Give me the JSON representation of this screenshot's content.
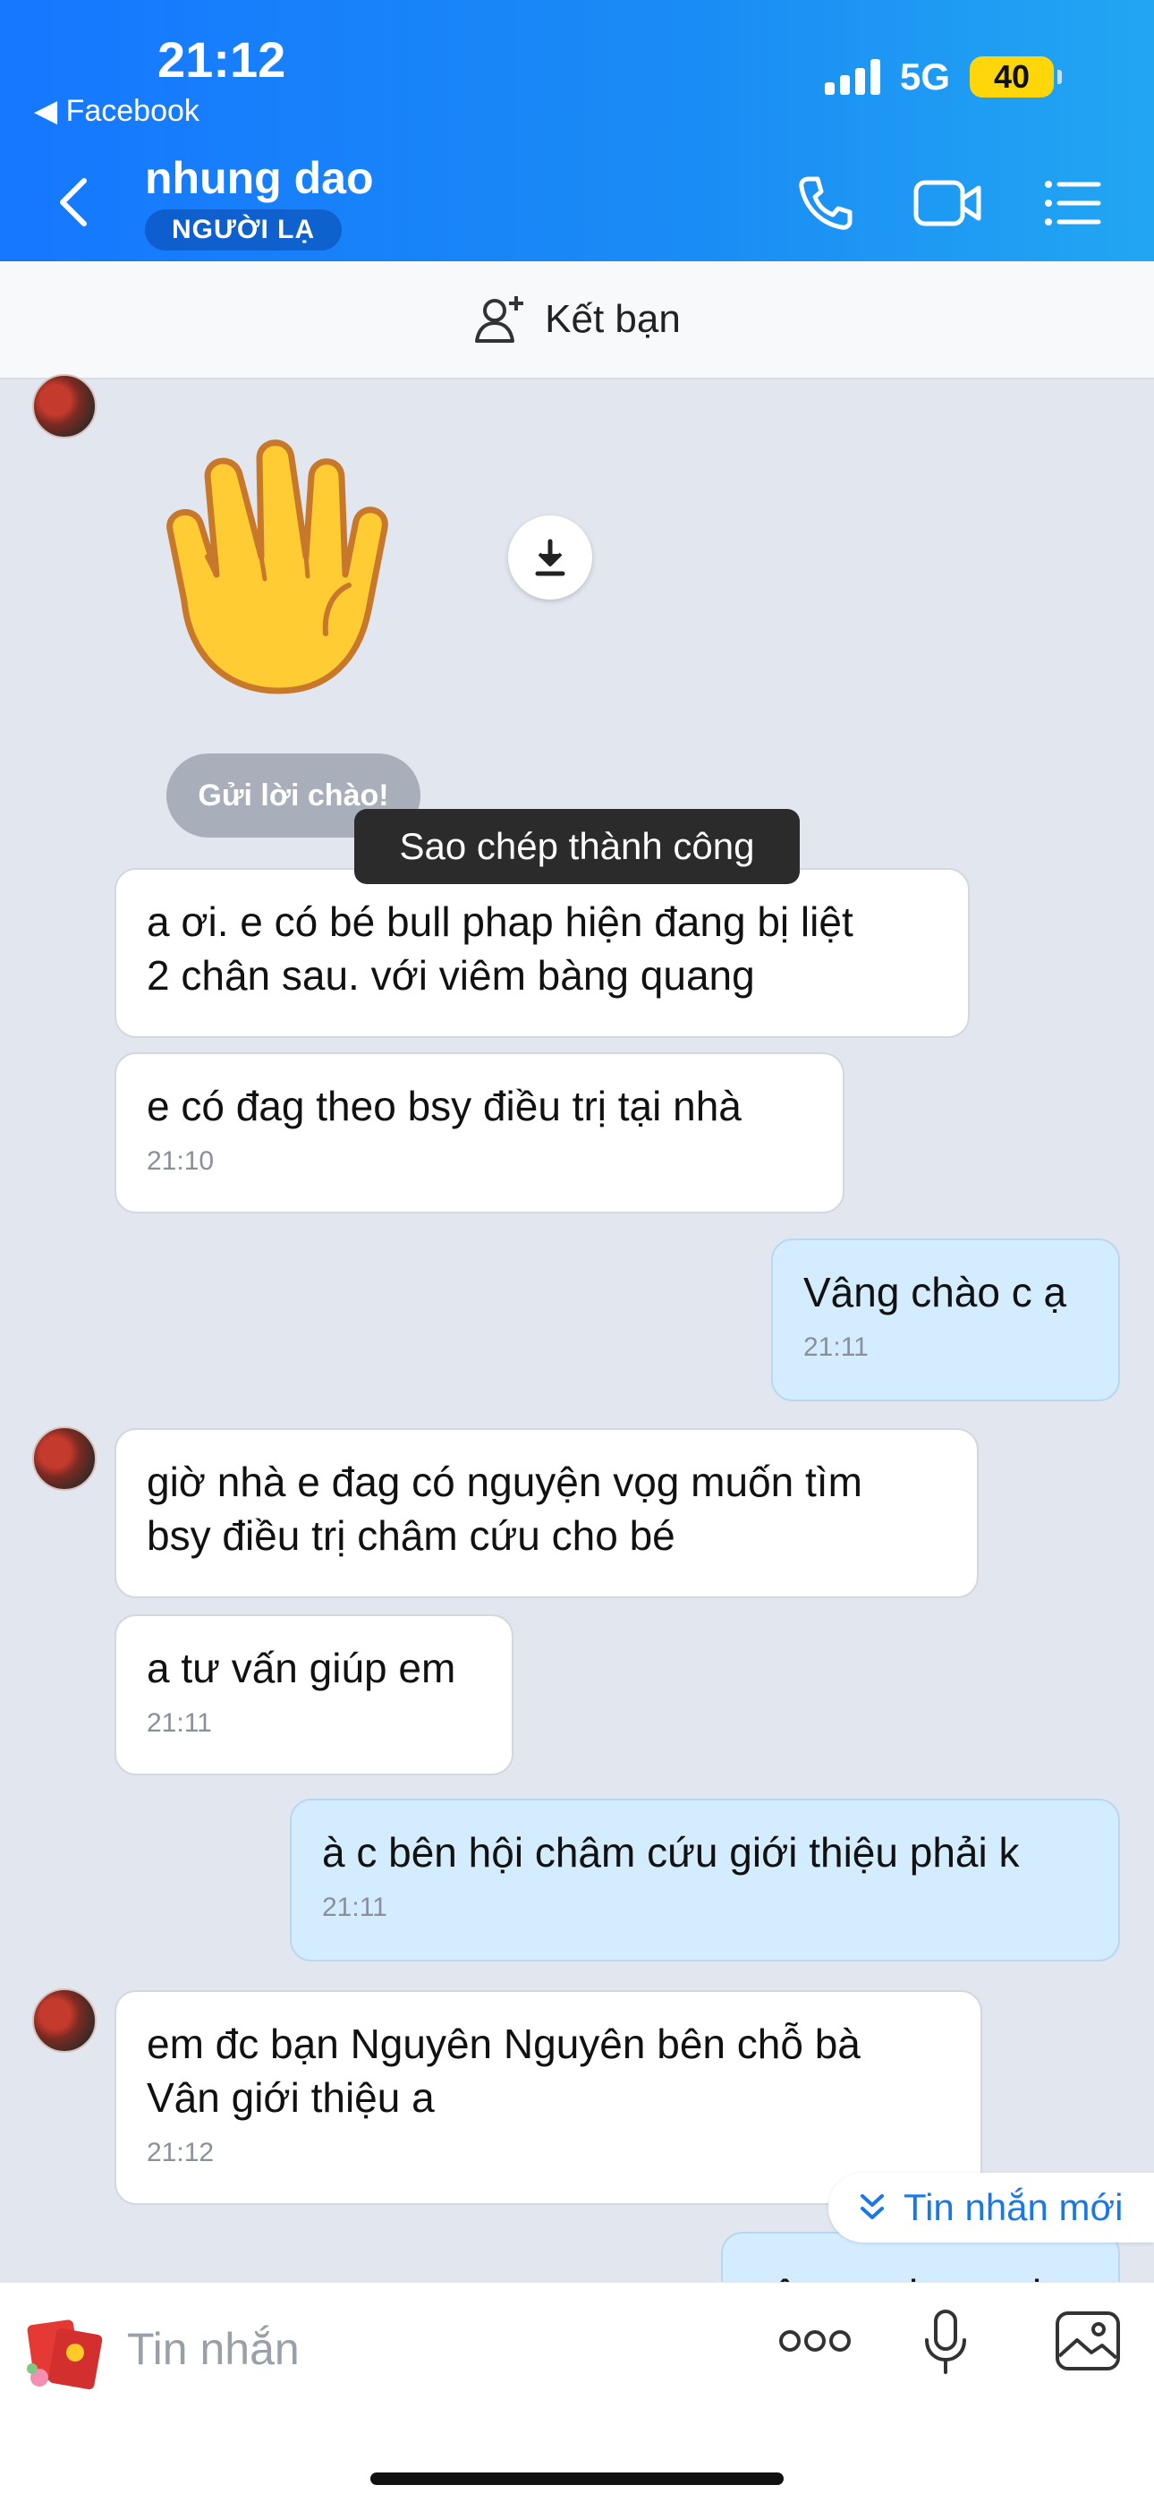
{
  "status_bar": {
    "time": "21:12",
    "back_app": "Facebook",
    "network": "5G",
    "battery": "40"
  },
  "header": {
    "contact_name": "nhung dao",
    "badge": "NGƯỜI LẠ"
  },
  "add_friend": {
    "label": "Kết bạn"
  },
  "sticker": {
    "name": "waving-hand-sticker"
  },
  "wave_chip": {
    "label": "Gửi lời chào!"
  },
  "toast": {
    "text": "Sao chép thành công"
  },
  "messages": [
    {
      "dir": "in",
      "lines": [
        "a ơi. e có bé bull phap hiện đang bị liệt",
        "2 chân sau. với viêm bàng quang"
      ],
      "time": ""
    },
    {
      "dir": "in",
      "lines": [
        "e có đag theo bsy điều trị tại nhà"
      ],
      "time": "21:10"
    },
    {
      "dir": "out",
      "lines": [
        "Vâng chào c ạ"
      ],
      "time": "21:11"
    },
    {
      "dir": "in",
      "lines": [
        "giờ nhà e đag có nguyện vọg muốn tìm",
        "bsy điều trị châm cứu cho bé"
      ],
      "time": ""
    },
    {
      "dir": "in",
      "lines": [
        "a tư vấn giúp em"
      ],
      "time": "21:11"
    },
    {
      "dir": "out",
      "lines": [
        "à c bên hội châm cứu giới thiệu phải k"
      ],
      "time": "21:11"
    },
    {
      "dir": "in",
      "lines": [
        "em đc bạn Nguyên Nguyên bên chỗ bà",
        "Vân giới thiệu a"
      ],
      "time": "21:12"
    },
    {
      "dir": "out",
      "lines": [
        "vâng ạ cho c sdt"
      ],
      "time": ""
    }
  ],
  "new_messages": {
    "label": "Tin nhắn mới"
  },
  "composer": {
    "placeholder": "Tin nhắn"
  },
  "colors": {
    "header_start": "#1677ff",
    "header_end": "#22a6f2",
    "out_bubble": "#d4ecff",
    "accent": "#1a78e6"
  },
  "icons": [
    "chevron-left-icon",
    "phone-icon",
    "video-icon",
    "menu-list-icon",
    "add-user-icon",
    "download-icon",
    "chevron-down-double-icon",
    "red-envelope-icon",
    "more-dots-icon",
    "microphone-icon",
    "image-icon"
  ]
}
